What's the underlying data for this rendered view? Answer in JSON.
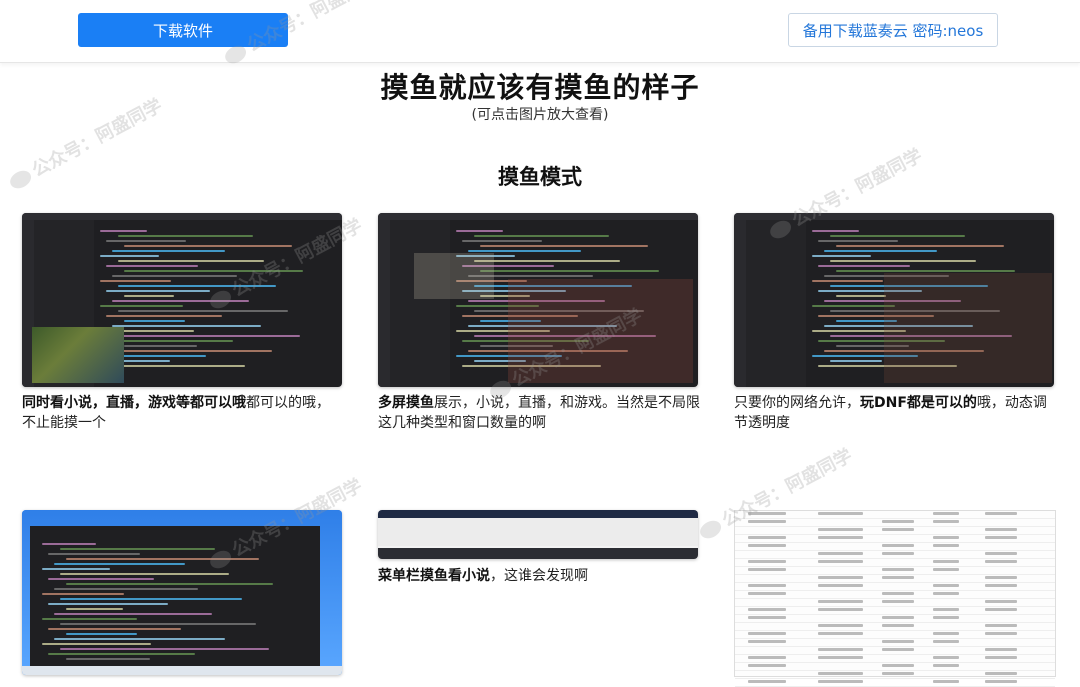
{
  "topbar": {
    "download_label": "下载软件",
    "backup_label": "备用下载蓝奏云 密码:neos"
  },
  "page": {
    "title": "摸鱼就应该有摸鱼的样子",
    "subtitle": "(可点击图片放大查看)",
    "section_title": "摸鱼模式"
  },
  "cards": [
    {
      "caption_bold": "同时看小说，直播，游戏等都可以哦",
      "caption_rest": "都可以的哦，不止能摸一个"
    },
    {
      "caption_bold": "多屏摸鱼",
      "caption_rest": "展示，小说，直播，和游戏。当然是不局限这几种类型和窗口数量的啊"
    },
    {
      "caption_pre": "只要你的网络允许，",
      "caption_bold": "玩DNF都是可以的",
      "caption_rest": "哦，动态调节透明度"
    },
    {
      "caption_bold": "",
      "caption_rest": ""
    },
    {
      "caption_bold": "菜单栏摸鱼看小说",
      "caption_rest": "，这谁会发现啊"
    },
    {
      "caption_bold": "",
      "caption_rest": ""
    }
  ],
  "watermark": "公众号：阿盛同学",
  "colors": {
    "primary": "#1a7ff5",
    "link": "#2477d9",
    "editor_bg": "#1f1f22"
  }
}
